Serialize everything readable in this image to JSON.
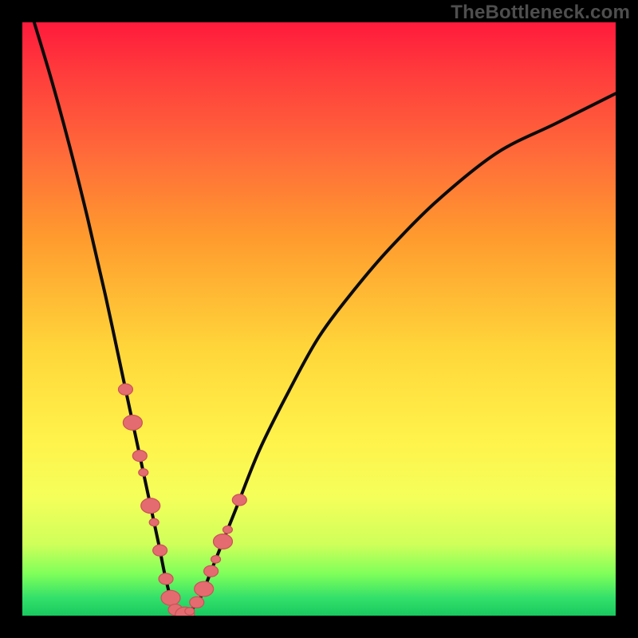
{
  "watermark": "TheBottleneck.com",
  "chart_data": {
    "type": "line",
    "title": "",
    "xlabel": "",
    "ylabel": "",
    "xlim": [
      0,
      100
    ],
    "ylim": [
      0,
      100
    ],
    "grid": false,
    "series": [
      {
        "name": "bottleneck-curve",
        "x": [
          2,
          5,
          8,
          11,
          14,
          17,
          18.5,
          20,
          21.5,
          23,
          24,
          25,
          26,
          27,
          28,
          30,
          32,
          36,
          40,
          45,
          50,
          56,
          62,
          70,
          80,
          90,
          100
        ],
        "y": [
          100,
          90,
          79,
          67,
          54,
          40,
          33,
          26,
          19,
          12,
          7,
          3,
          0.5,
          0,
          0.5,
          3,
          8,
          18,
          28,
          38,
          47,
          55,
          62,
          70,
          78,
          83,
          88
        ]
      }
    ],
    "markers": {
      "name": "highlight-beads",
      "on_curve": true,
      "clusters": [
        {
          "side": "left",
          "x": [
            17.4,
            18.6,
            19.8,
            20.4,
            21.6,
            22.2,
            23.2
          ]
        },
        {
          "side": "bottom",
          "x": [
            24.2,
            25.0,
            25.8,
            26.6,
            27.4,
            28.2
          ]
        },
        {
          "side": "right",
          "x": [
            29.4,
            30.6,
            31.8,
            32.6,
            33.8,
            34.6,
            36.6
          ]
        }
      ],
      "radius_px": [
        6,
        12
      ]
    },
    "colors": {
      "curve": "#0b0b0b",
      "bead_fill": "#e46b70",
      "bead_stroke": "#c95358",
      "gradient_top": "#ff1a3c",
      "gradient_bottom": "#19c95f"
    }
  }
}
